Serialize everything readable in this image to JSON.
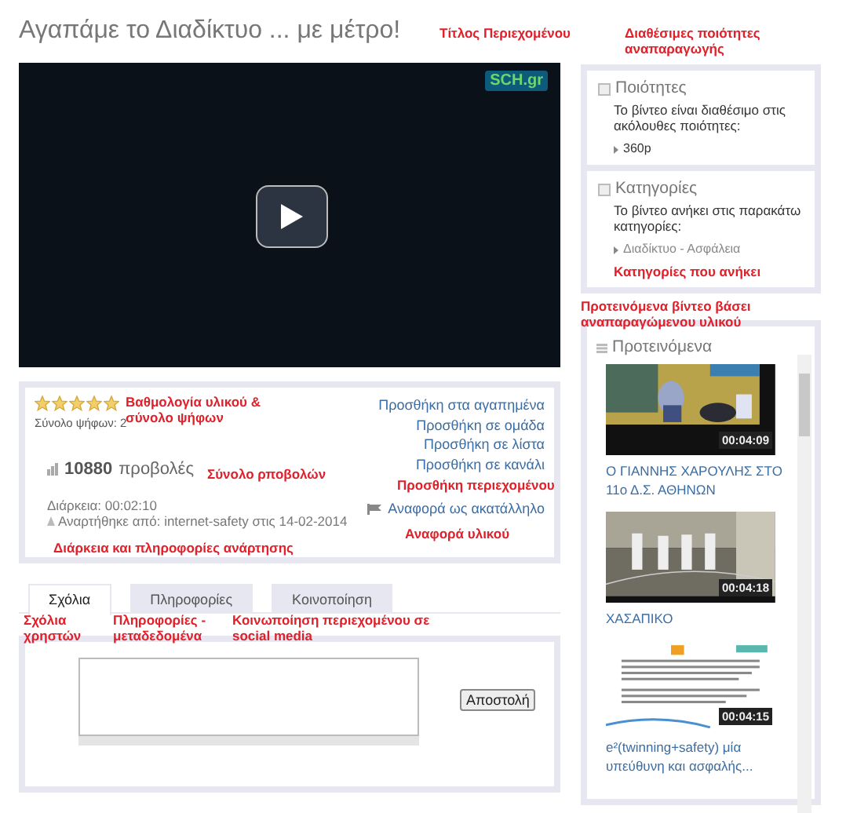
{
  "title": "Αγαπάμε το Διαδίκτυο ... με μέτρο!",
  "video": {
    "logo": "SCH.gr"
  },
  "rating": {
    "stars": 5,
    "votes": "Σύνολο ψήφων: 2",
    "views_count": "10880",
    "views_label": "προβολές",
    "duration": "Διάρκεια: 00:02:10",
    "uploaded": "Αναρτήθηκε από: internet-safety στις 14-02-2014"
  },
  "actions": [
    "Προσθήκη στα αγαπημένα",
    "Προσθήκη σε ομάδα",
    "Προσθήκη σε λίστα",
    "Προσθήκη σε κανάλι"
  ],
  "report": "Αναφορά ως ακατάλληλο",
  "tabs": [
    {
      "label": "Σχόλια",
      "selected": true
    },
    {
      "label": "Πληροφορίες",
      "selected": false
    },
    {
      "label": "Κοινοποίηση",
      "selected": false
    }
  ],
  "comment": {
    "send_button": "Αποστολή"
  },
  "qualities": {
    "heading": "Ποιότητες",
    "text": "Το βίντεο είναι διαθέσιμο στις ακόλουθες ποιότητες:",
    "items": [
      "360p"
    ]
  },
  "categories": {
    "heading": "Κατηγορίες",
    "text": "Το βίντεο ανήκει στις παρακάτω κατηγορίες:",
    "items": [
      "Διαδίκτυο - Ασφάλεια"
    ]
  },
  "recommended": {
    "heading": "Προτεινόμενα",
    "videos": [
      {
        "duration": "00:04:09",
        "title": "Ο ΓΙΑΝΝΗΣ ΧΑΡΟΥΛΗΣ ΣΤΟ 11ο Δ.Σ. ΑΘΗΝΩΝ"
      },
      {
        "duration": "00:04:18",
        "title": "ΧΑΣΑΠΙΚΟ"
      },
      {
        "duration": "00:04:15",
        "title": "e²(twinning+safety) μία υπεύθυνη και ασφαλής..."
      }
    ]
  },
  "annotations": [
    {
      "kind": "title",
      "text": "Τίτλος Περιεχομένου"
    },
    {
      "kind": "qualities",
      "text": "Διαθέσιμες ποιότητες αναπαραγωγής"
    },
    {
      "kind": "rating",
      "text": "Βαθμολογία υλικού & σύνολο ψήφων"
    },
    {
      "kind": "views",
      "text": "Σύνολο ρποβολών"
    },
    {
      "kind": "add",
      "text": "Προσθήκη περιεχομένου"
    },
    {
      "kind": "info",
      "text": "Διάρκεια και πληροφορίες ανάρτησης"
    },
    {
      "kind": "report",
      "text": "Αναφορά υλικού"
    },
    {
      "kind": "categories",
      "text": "Κατηγορίες που ανήκει"
    },
    {
      "kind": "recommended",
      "text": "Προτεινόμενα βίντεο βάσει αναπαραγώμενου υλικού"
    },
    {
      "kind": "tab0",
      "text": "Σχόλια χρηστών"
    },
    {
      "kind": "tab1",
      "text": "Πληροφορίες - μεταδεδομένα"
    },
    {
      "kind": "tab2",
      "text": "Κοινωποίηση περιεχομένου σε social media"
    }
  ]
}
